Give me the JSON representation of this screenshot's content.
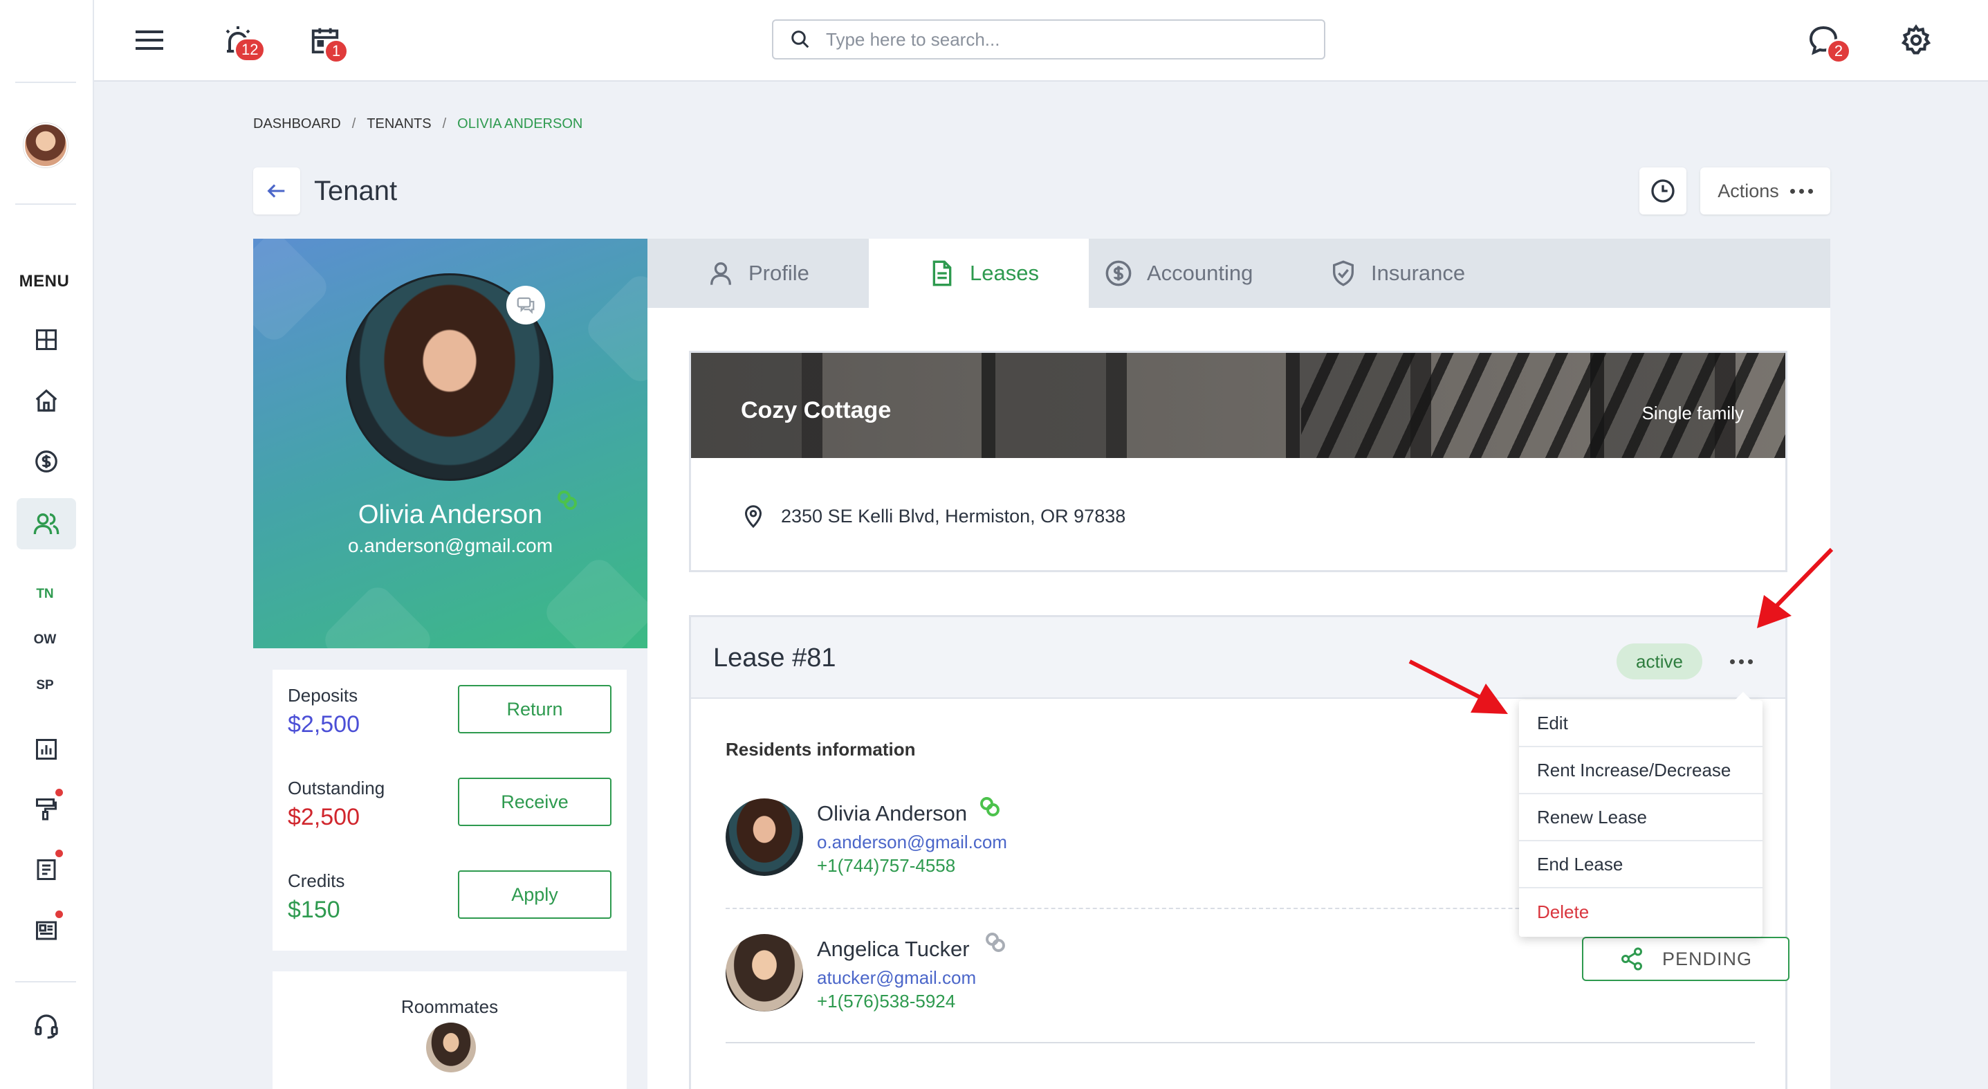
{
  "topbar": {
    "alarm_badge": "12",
    "calendar_badge": "1",
    "chat_badge": "2",
    "search_placeholder": "Type here to search..."
  },
  "sidebar": {
    "menu_label": "MENU",
    "shortcuts": [
      "TN",
      "OW",
      "SP"
    ]
  },
  "breadcrumb": {
    "items": [
      "DASHBOARD",
      "TENANTS",
      "OLIVIA ANDERSON"
    ],
    "separator": "/"
  },
  "header": {
    "title": "Tenant",
    "actions_label": "Actions"
  },
  "profile": {
    "name": "Olivia Anderson",
    "email": "o.anderson@gmail.com"
  },
  "balances": [
    {
      "label": "Deposits",
      "value": "$2,500",
      "button": "Return",
      "color": "#4b4fd6"
    },
    {
      "label": "Outstanding",
      "value": "$2,500",
      "button": "Receive",
      "color": "#d0262d"
    },
    {
      "label": "Credits",
      "value": "$150",
      "button": "Apply",
      "color": "#2e9a4f"
    }
  ],
  "roommates": {
    "title": "Roommates"
  },
  "tabs": [
    {
      "label": "Profile",
      "icon": "user-icon",
      "active": false
    },
    {
      "label": "Leases",
      "icon": "document-icon",
      "active": true
    },
    {
      "label": "Accounting",
      "icon": "dollar-icon",
      "active": false
    },
    {
      "label": "Insurance",
      "icon": "shield-icon",
      "active": false
    }
  ],
  "property": {
    "name": "Cozy Cottage",
    "type": "Single family",
    "address": "2350 SE Kelli Blvd, Hermiston, OR 97838"
  },
  "lease": {
    "title": "Lease #81",
    "status": "active",
    "residents_title": "Residents information",
    "residents": [
      {
        "name": "Olivia Anderson",
        "email": "o.anderson@gmail.com",
        "phone": "+1(744)757-4558",
        "linked": true
      },
      {
        "name": "Angelica Tucker",
        "email": "atucker@gmail.com",
        "phone": "+1(576)538-5924",
        "linked": false,
        "action": "PENDING"
      }
    ]
  },
  "lease_menu": {
    "items": [
      "Edit",
      "Rent Increase/Decrease",
      "Renew Lease",
      "End Lease",
      "Delete"
    ]
  },
  "colors": {
    "accent": "#2e9a4f",
    "danger": "#d9363e",
    "link": "#4b66c9",
    "badge": "#e03b3b",
    "annotation_arrow": "#e8131b"
  }
}
